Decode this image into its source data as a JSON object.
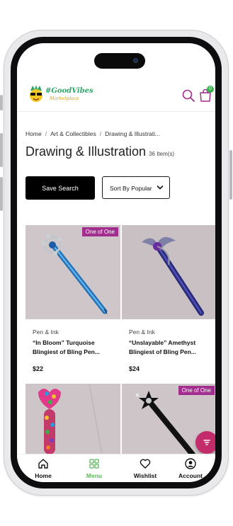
{
  "app": {
    "logo_text_top": "#GoodVibes",
    "logo_text_bottom": "Marketplace",
    "cart_count": "0",
    "accent_color": "#a22f8e",
    "active_color": "#5cb85c"
  },
  "breadcrumb": [
    "Home",
    "Art & Collectibles",
    "Drawing & Illustrati..."
  ],
  "page": {
    "title": "Drawing & Illustration",
    "item_count": "36 Item(s)"
  },
  "controls": {
    "save_search_label": "Save Search",
    "sort_label": "Sort By Popularity"
  },
  "products": [
    {
      "badge": "One of One",
      "category": "Pen & Ink",
      "name": "“In Bloom” Turquoise Blingiest of Bling Pen...",
      "price": "$22"
    },
    {
      "badge": "",
      "category": "Pen & Ink",
      "name": "“Unslayable” Amethyst Blingiest of Bling Pen...",
      "price": "$24"
    },
    {
      "badge": "",
      "category": "",
      "name": "",
      "price": ""
    },
    {
      "badge": "One of One",
      "category": "",
      "name": "",
      "price": ""
    }
  ],
  "bottom_nav": [
    {
      "label": "Home",
      "icon": "home-icon"
    },
    {
      "label": "Menu",
      "icon": "grid-icon"
    },
    {
      "label": "Wishlist",
      "icon": "heart-icon"
    },
    {
      "label": "Account",
      "icon": "account-icon"
    }
  ]
}
